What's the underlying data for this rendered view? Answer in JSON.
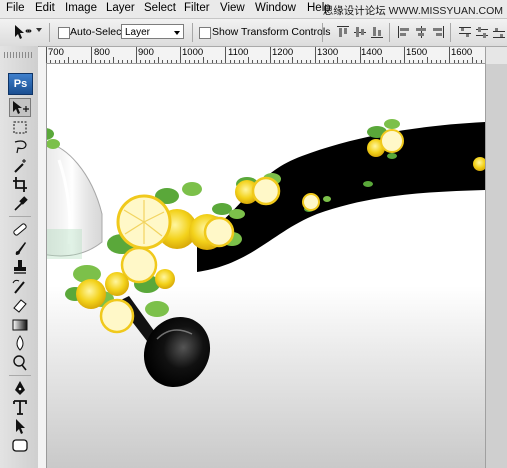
{
  "menu": {
    "items": [
      "File",
      "Edit",
      "Image",
      "Layer",
      "Select",
      "Filter",
      "View",
      "Window",
      "Help"
    ],
    "watermark": "思缘设计论坛 WWW.MISSYUAN.COM"
  },
  "options_bar": {
    "auto_select_label": "Auto-Select:",
    "auto_select_checked": false,
    "auto_select_value": "Layer",
    "show_transform_label": "Show Transform Controls",
    "show_transform_checked": false
  },
  "ruler": {
    "top_labels": [
      "700",
      "800",
      "900",
      "1000",
      "1100",
      "1200",
      "1300",
      "1400",
      "1500",
      "1600"
    ]
  },
  "toolbox": {
    "logo": "Ps",
    "tools": [
      "move-tool",
      "marquee-tool",
      "lasso-tool",
      "magic-wand-tool",
      "crop-tool",
      "eyedropper-tool",
      "healing-brush-tool",
      "brush-tool",
      "clone-stamp-tool",
      "history-brush-tool",
      "eraser-tool",
      "gradient-tool",
      "blur-tool",
      "dodge-tool",
      "pen-tool",
      "type-tool",
      "path-selection-tool",
      "rectangle-tool"
    ],
    "active_tool": "move-tool"
  },
  "colors": {
    "menu_bg": "#eaeaea",
    "canvas_bg": "#ffffff",
    "ribbon": "#000000",
    "lemon": "#f3d21b",
    "leaf": "#5aa83a"
  }
}
